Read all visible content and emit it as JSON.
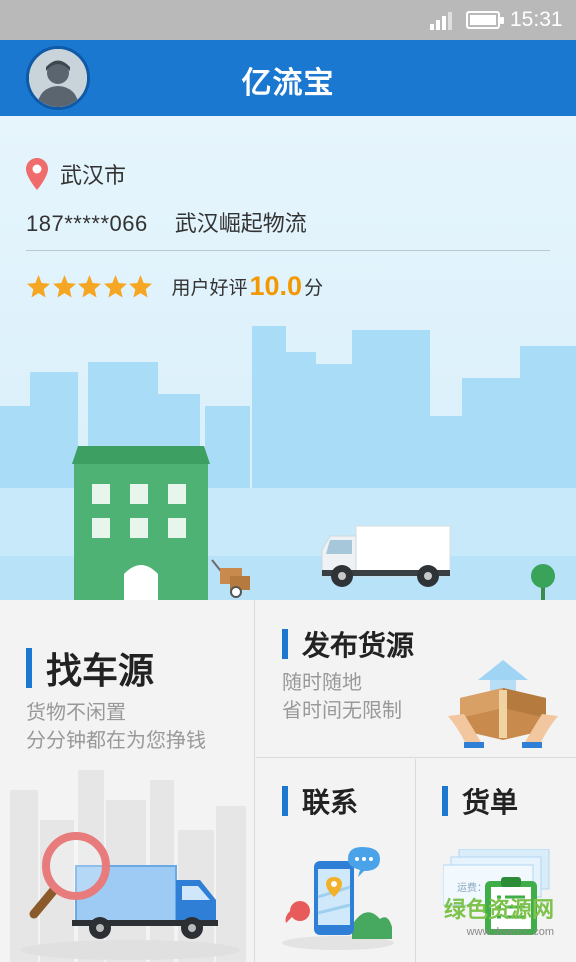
{
  "status_bar": {
    "time": "15:31",
    "icons": [
      "signal-icon",
      "battery-icon"
    ]
  },
  "header": {
    "title": "亿流宝",
    "avatar_icon": "avatar-icon"
  },
  "profile": {
    "city": "武汉市",
    "phone": "187*****066",
    "company": "武汉崛起物流",
    "rating_label": "用户好评",
    "rating_score": "10.0",
    "rating_unit": "分",
    "stars": 5
  },
  "tiles": {
    "find_vehicle": {
      "title": "找车源",
      "subtitle_1": "货物不闲置",
      "subtitle_2": "分分钟都在为您挣钱"
    },
    "publish_cargo": {
      "title": "发布货源",
      "subtitle_1": "随时随地",
      "subtitle_2": "省时间无限制"
    },
    "contacts": {
      "title": "联系"
    },
    "orders": {
      "title": "货单",
      "ticket_text": "运费：1,0000"
    }
  },
  "watermark": {
    "text": "绿色资源网",
    "url": "www.downcc.com"
  },
  "colors": {
    "primary": "#1b78d0",
    "rating": "#f39800",
    "star": "#f5a623",
    "pin": "#f06b6b"
  }
}
